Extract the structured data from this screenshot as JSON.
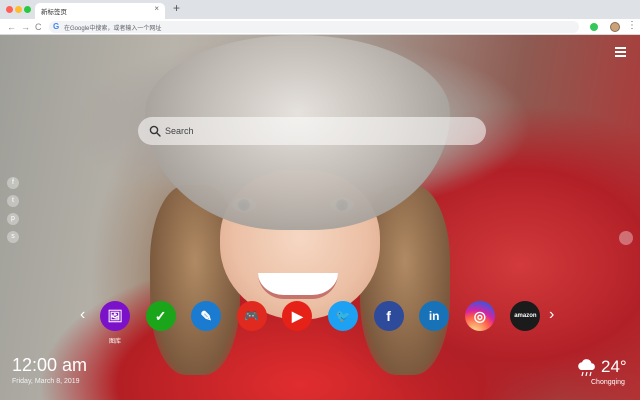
{
  "browser": {
    "tab_title": "新标签页",
    "tab_close": "×",
    "new_tab": "+",
    "address_placeholder": "在Google中搜索，或者输入一个网址",
    "back": "←",
    "forward": "→",
    "reload": "C",
    "menu": "⋮",
    "google_letter": "G"
  },
  "page": {
    "search": {
      "placeholder": "Search"
    },
    "social_icons": [
      "facebook-icon",
      "twitter-icon",
      "pinterest-icon",
      "share-icon"
    ],
    "social_glyphs": [
      "f",
      "t",
      "p",
      "s"
    ],
    "dock": [
      {
        "name": "gallery",
        "label": "图库",
        "color": "#7b12c9",
        "glyph": "🖼"
      },
      {
        "name": "tasks",
        "color": "#1aa51a",
        "glyph": "✓"
      },
      {
        "name": "notes",
        "color": "#1a7bd0",
        "glyph": "✎"
      },
      {
        "name": "games",
        "color": "#e02a1f",
        "glyph": "🎮"
      },
      {
        "name": "youtube",
        "color": "#e62117",
        "glyph": "▶"
      },
      {
        "name": "twitter",
        "color": "#1da1f2",
        "glyph": "🐦"
      },
      {
        "name": "facebook",
        "color": "#2d4a9b",
        "glyph": "f"
      },
      {
        "name": "linkedin",
        "color": "#1872b8",
        "glyph": "in"
      },
      {
        "name": "instagram",
        "color": "#c13584",
        "glyph": "◎"
      },
      {
        "name": "amazon",
        "color": "#1b1b1b",
        "glyph": "amazon"
      }
    ],
    "dock_prev": "‹",
    "dock_next": "›",
    "clock": {
      "time": "12:00 am",
      "date": "Friday, March 8, 2019"
    },
    "weather": {
      "temp": "24°",
      "city": "Chongqing",
      "icon": "cloud-rain-icon"
    }
  }
}
